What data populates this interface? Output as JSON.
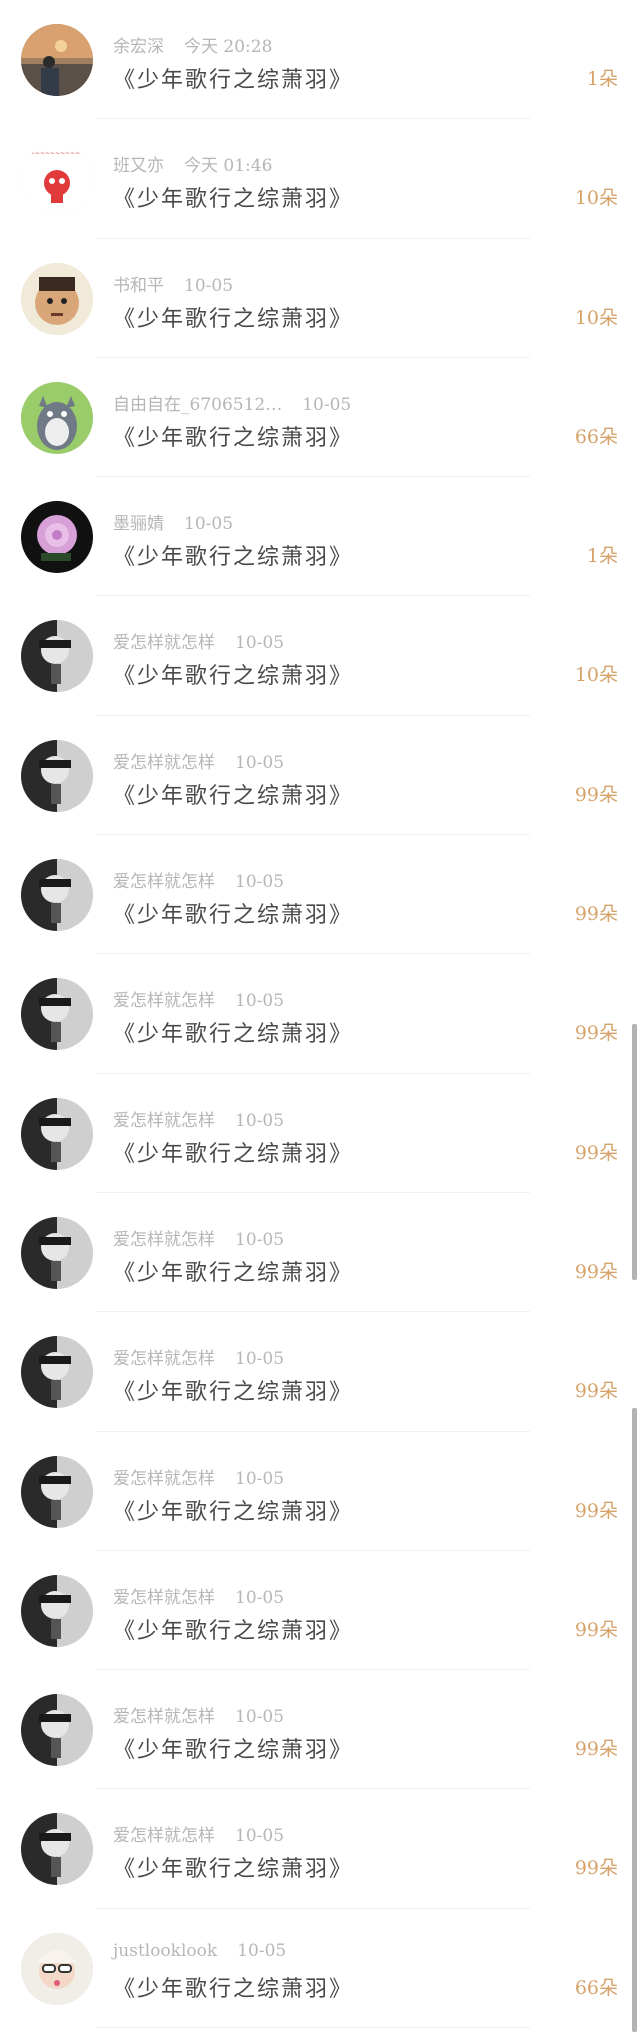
{
  "items": [
    {
      "name": "余宏深",
      "time": "今天 20:28",
      "title": "《少年歌行之综萧羽》",
      "count": "1朵",
      "avatar": "sunset-avatar"
    },
    {
      "name": "班又亦",
      "time": "今天 01:46",
      "title": "《少年歌行之综萧羽》",
      "count": "10朵",
      "avatar": "red-cartoon-avatar"
    },
    {
      "name": "书和平",
      "time": "10-05",
      "title": "《少年歌行之综萧羽》",
      "count": "10朵",
      "avatar": "baby-face-avatar"
    },
    {
      "name": "自由自在_6706512…",
      "time": "10-05",
      "title": "《少年歌行之综萧羽》",
      "count": "66朵",
      "avatar": "totoro-avatar"
    },
    {
      "name": "墨骊婧",
      "time": "10-05",
      "title": "《少年歌行之综萧羽》",
      "count": "1朵",
      "avatar": "pink-rose-avatar"
    },
    {
      "name": "爱怎样就怎样",
      "time": "10-05",
      "title": "《少年歌行之综萧羽》",
      "count": "10朵",
      "avatar": "gray-portrait-avatar"
    },
    {
      "name": "爱怎样就怎样",
      "time": "10-05",
      "title": "《少年歌行之综萧羽》",
      "count": "99朵",
      "avatar": "gray-portrait-avatar"
    },
    {
      "name": "爱怎样就怎样",
      "time": "10-05",
      "title": "《少年歌行之综萧羽》",
      "count": "99朵",
      "avatar": "gray-portrait-avatar"
    },
    {
      "name": "爱怎样就怎样",
      "time": "10-05",
      "title": "《少年歌行之综萧羽》",
      "count": "99朵",
      "avatar": "gray-portrait-avatar"
    },
    {
      "name": "爱怎样就怎样",
      "time": "10-05",
      "title": "《少年歌行之综萧羽》",
      "count": "99朵",
      "avatar": "gray-portrait-avatar"
    },
    {
      "name": "爱怎样就怎样",
      "time": "10-05",
      "title": "《少年歌行之综萧羽》",
      "count": "99朵",
      "avatar": "gray-portrait-avatar"
    },
    {
      "name": "爱怎样就怎样",
      "time": "10-05",
      "title": "《少年歌行之综萧羽》",
      "count": "99朵",
      "avatar": "gray-portrait-avatar"
    },
    {
      "name": "爱怎样就怎样",
      "time": "10-05",
      "title": "《少年歌行之综萧羽》",
      "count": "99朵",
      "avatar": "gray-portrait-avatar"
    },
    {
      "name": "爱怎样就怎样",
      "time": "10-05",
      "title": "《少年歌行之综萧羽》",
      "count": "99朵",
      "avatar": "gray-portrait-avatar"
    },
    {
      "name": "爱怎样就怎样",
      "time": "10-05",
      "title": "《少年歌行之综萧羽》",
      "count": "99朵",
      "avatar": "gray-portrait-avatar"
    },
    {
      "name": "爱怎样就怎样",
      "time": "10-05",
      "title": "《少年歌行之综萧羽》",
      "count": "99朵",
      "avatar": "gray-portrait-avatar"
    },
    {
      "name": "justlooklook",
      "time": "10-05",
      "title": "《少年歌行之综萧羽》",
      "count": "66朵",
      "avatar": "girl-sunglasses-avatar"
    }
  ],
  "colors": {
    "count": "#d6a36a",
    "meta": "#b6b6b6",
    "title": "#4a4a4a"
  }
}
